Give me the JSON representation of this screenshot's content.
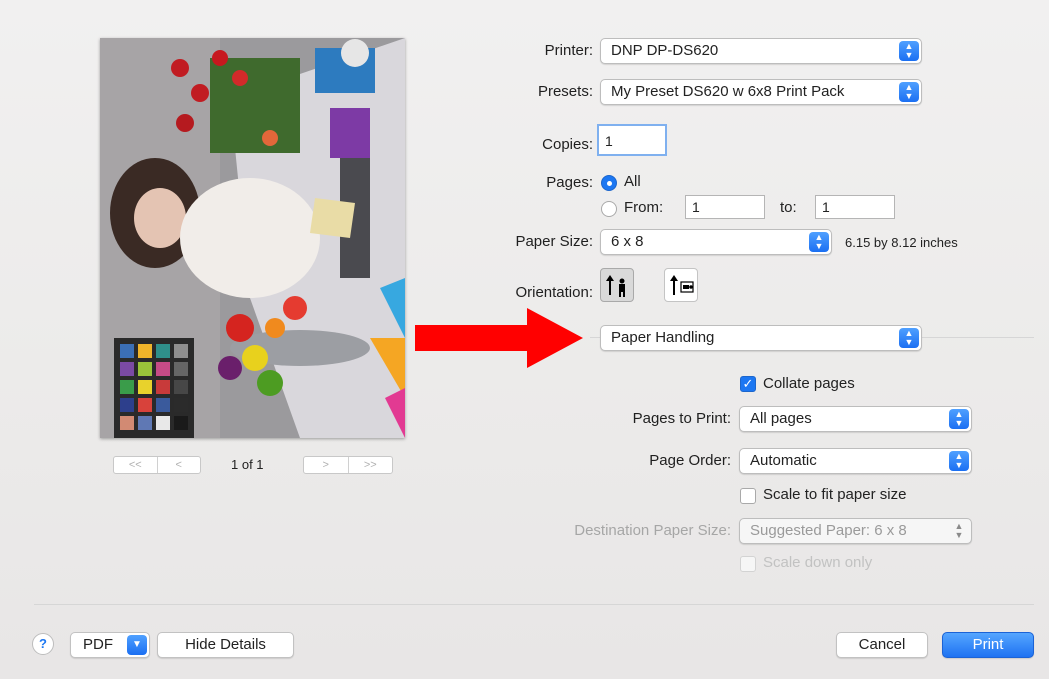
{
  "print": {
    "printer_label": "Printer:",
    "printer_value": "DNP DP-DS620",
    "presets_label": "Presets:",
    "presets_value": "My Preset DS620 w 6x8 Print Pack",
    "copies_label": "Copies:",
    "copies_value": "1",
    "pages_label": "Pages:",
    "pages_all": "All",
    "pages_from_label": "From:",
    "pages_from_value": "1",
    "pages_to_label": "to:",
    "pages_to_value": "1",
    "paper_size_label": "Paper Size:",
    "paper_size_value": "6 x 8",
    "paper_size_dims": "6.15 by 8.12 inches",
    "orientation_label": "Orientation:",
    "section_value": "Paper Handling",
    "collate_label": "Collate pages",
    "pages_to_print_label": "Pages to Print:",
    "pages_to_print_value": "All pages",
    "page_order_label": "Page Order:",
    "page_order_value": "Automatic",
    "scale_fit_label": "Scale to fit paper size",
    "dest_paper_label": "Destination Paper Size:",
    "dest_paper_value": "Suggested Paper: 6 x 8",
    "scale_down_label": "Scale down only"
  },
  "preview": {
    "page_indicator": "1 of 1",
    "first": "<<",
    "prev": "<",
    "next": ">",
    "last": ">>"
  },
  "footer": {
    "help": "?",
    "pdf": "PDF",
    "hide_details": "Hide Details",
    "cancel": "Cancel",
    "print": "Print"
  },
  "annotation": {
    "arrow_color": "#ff0000"
  }
}
